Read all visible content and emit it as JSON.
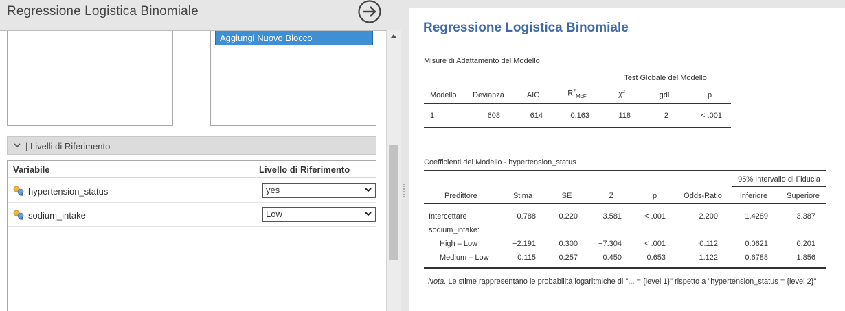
{
  "left": {
    "title": "Regressione Logistica Binomiale",
    "add_block_label": "Aggiungi Nuovo Blocco",
    "section_label": "| Livelli di Riferimento",
    "ref_table": {
      "headers": [
        "Variabile",
        "Livello di Riferimento"
      ],
      "rows": [
        {
          "variable": "hypertension_status",
          "level": "yes"
        },
        {
          "variable": "sodium_intake",
          "level": "Low"
        }
      ]
    }
  },
  "results": {
    "title": "Regressione Logistica Binomiale",
    "fit_table": {
      "title": "Misure di Adattamento del Modello",
      "group_header": "Test Globale del Modello",
      "headers": [
        "Modello",
        "Devianza",
        "AIC",
        "R²McF",
        "χ²",
        "gdl",
        "p"
      ],
      "r2_main": "R",
      "r2_sup": "2",
      "r2_sub": "McF",
      "chi_main": "χ",
      "chi_sup": "2",
      "row": [
        "1",
        "608",
        "614",
        "0.163",
        "118",
        "2",
        "< .001"
      ]
    },
    "coef_table": {
      "title": "Coefficienti del Modello - hypertension_status",
      "group_header": "95% Intervallo di Fiducia",
      "headers": [
        "Predittore",
        "Stima",
        "SE",
        "Z",
        "p",
        "Odds-Ratio",
        "Inferiore",
        "Superiore"
      ],
      "rows": [
        {
          "pred": "Intercettare",
          "stima": "0.788",
          "se": "0.220",
          "z": "3.581",
          "p": "< .001",
          "or": "2.200",
          "inf": "1.4289",
          "sup": "3.387"
        },
        {
          "pred": "sodium_intake:",
          "stima": "",
          "se": "",
          "z": "",
          "p": "",
          "or": "",
          "inf": "",
          "sup": ""
        },
        {
          "pred": "High – Low",
          "stima": "−2.191",
          "se": "0.300",
          "z": "−7.304",
          "p": "< .001",
          "or": "0.112",
          "inf": "0.0621",
          "sup": "0.201"
        },
        {
          "pred": "Medium – Low",
          "stima": "0.115",
          "se": "0.257",
          "z": "0.450",
          "p": "0.653",
          "or": "1.122",
          "inf": "0.6788",
          "sup": "1.856"
        }
      ],
      "note_label": "Nota.",
      "note_text": " Le stime rappresentano le probabilità logaritmiche di \"... = {level 1}\" rispetto a \"hypertension_status = {level 2}\""
    }
  },
  "colors": {
    "accent": "#3e8fd3",
    "results_title": "#3e6aa7"
  },
  "icons": [
    "arrow-right-circle-icon",
    "chevron-down-icon",
    "nominal-variable-icon",
    "dropdown-arrow-icon",
    "scroll-up-icon"
  ]
}
